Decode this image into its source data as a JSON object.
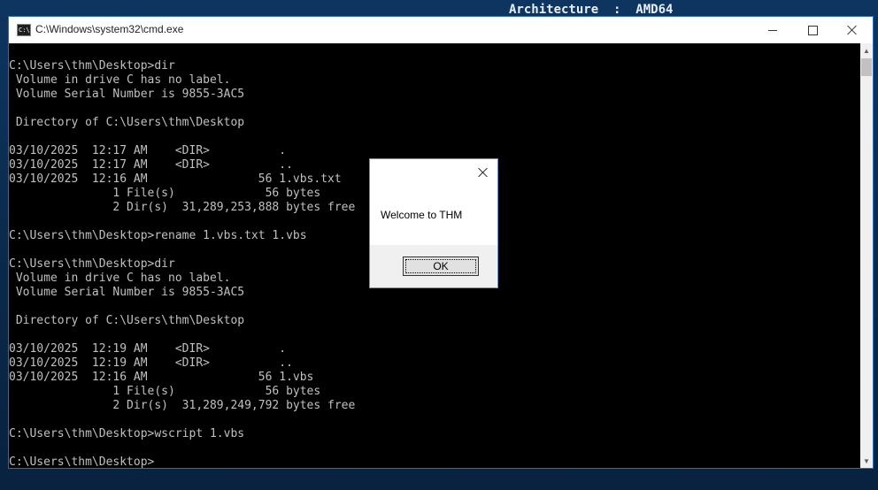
{
  "desktop": {
    "info_text": "Architecture  :  AMD64"
  },
  "window": {
    "title": "C:\\Windows\\system32\\cmd.exe",
    "icon": "cmd-icon",
    "controls": {
      "minimize": "minimize-icon",
      "maximize": "maximize-icon",
      "close": "close-icon"
    }
  },
  "console": {
    "lines": [
      "C:\\Users\\thm\\Desktop>dir",
      " Volume in drive C has no label.",
      " Volume Serial Number is 9855-3AC5",
      "",
      " Directory of C:\\Users\\thm\\Desktop",
      "",
      "03/10/2025  12:17 AM    <DIR>          .",
      "03/10/2025  12:17 AM    <DIR>          ..",
      "03/10/2025  12:16 AM                56 1.vbs.txt",
      "               1 File(s)             56 bytes",
      "               2 Dir(s)  31,289,253,888 bytes free",
      "",
      "C:\\Users\\thm\\Desktop>rename 1.vbs.txt 1.vbs",
      "",
      "C:\\Users\\thm\\Desktop>dir",
      " Volume in drive C has no label.",
      " Volume Serial Number is 9855-3AC5",
      "",
      " Directory of C:\\Users\\thm\\Desktop",
      "",
      "03/10/2025  12:19 AM    <DIR>          .",
      "03/10/2025  12:19 AM    <DIR>          ..",
      "03/10/2025  12:16 AM                56 1.vbs",
      "               1 File(s)             56 bytes",
      "               2 Dir(s)  31,289,249,792 bytes free",
      "",
      "C:\\Users\\thm\\Desktop>wscript 1.vbs",
      "",
      "C:\\Users\\thm\\Desktop>"
    ]
  },
  "message_box": {
    "text": "Welcome to THM",
    "ok_label": "OK"
  },
  "colors": {
    "console_bg": "#000000",
    "console_text": "#c0c0c0",
    "window_border": "#2d6db5"
  }
}
